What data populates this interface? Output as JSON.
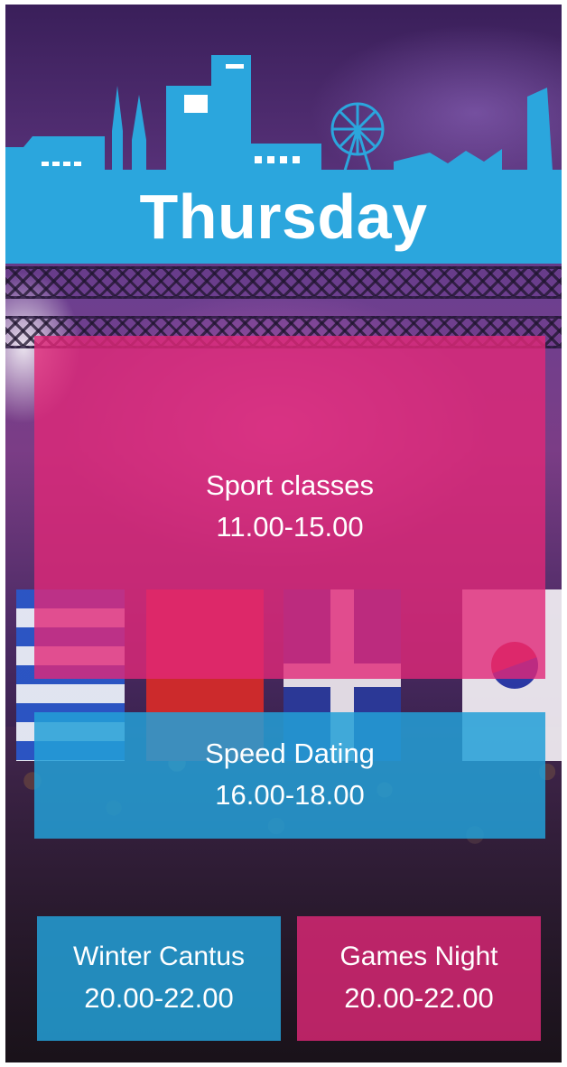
{
  "header": {
    "day": "Thursday"
  },
  "colors": {
    "banner": "#2ba6dd",
    "pink_card": "#e12878",
    "blue_card": "#23a0d7"
  },
  "events": [
    {
      "name": "Sport classes",
      "time": "11.00-15.00"
    },
    {
      "name": "Speed Dating",
      "time": "16.00-18.00"
    },
    {
      "name": "Winter Cantus",
      "time": "20.00-22.00"
    },
    {
      "name": "Games Night",
      "time": "20.00-22.00"
    }
  ]
}
